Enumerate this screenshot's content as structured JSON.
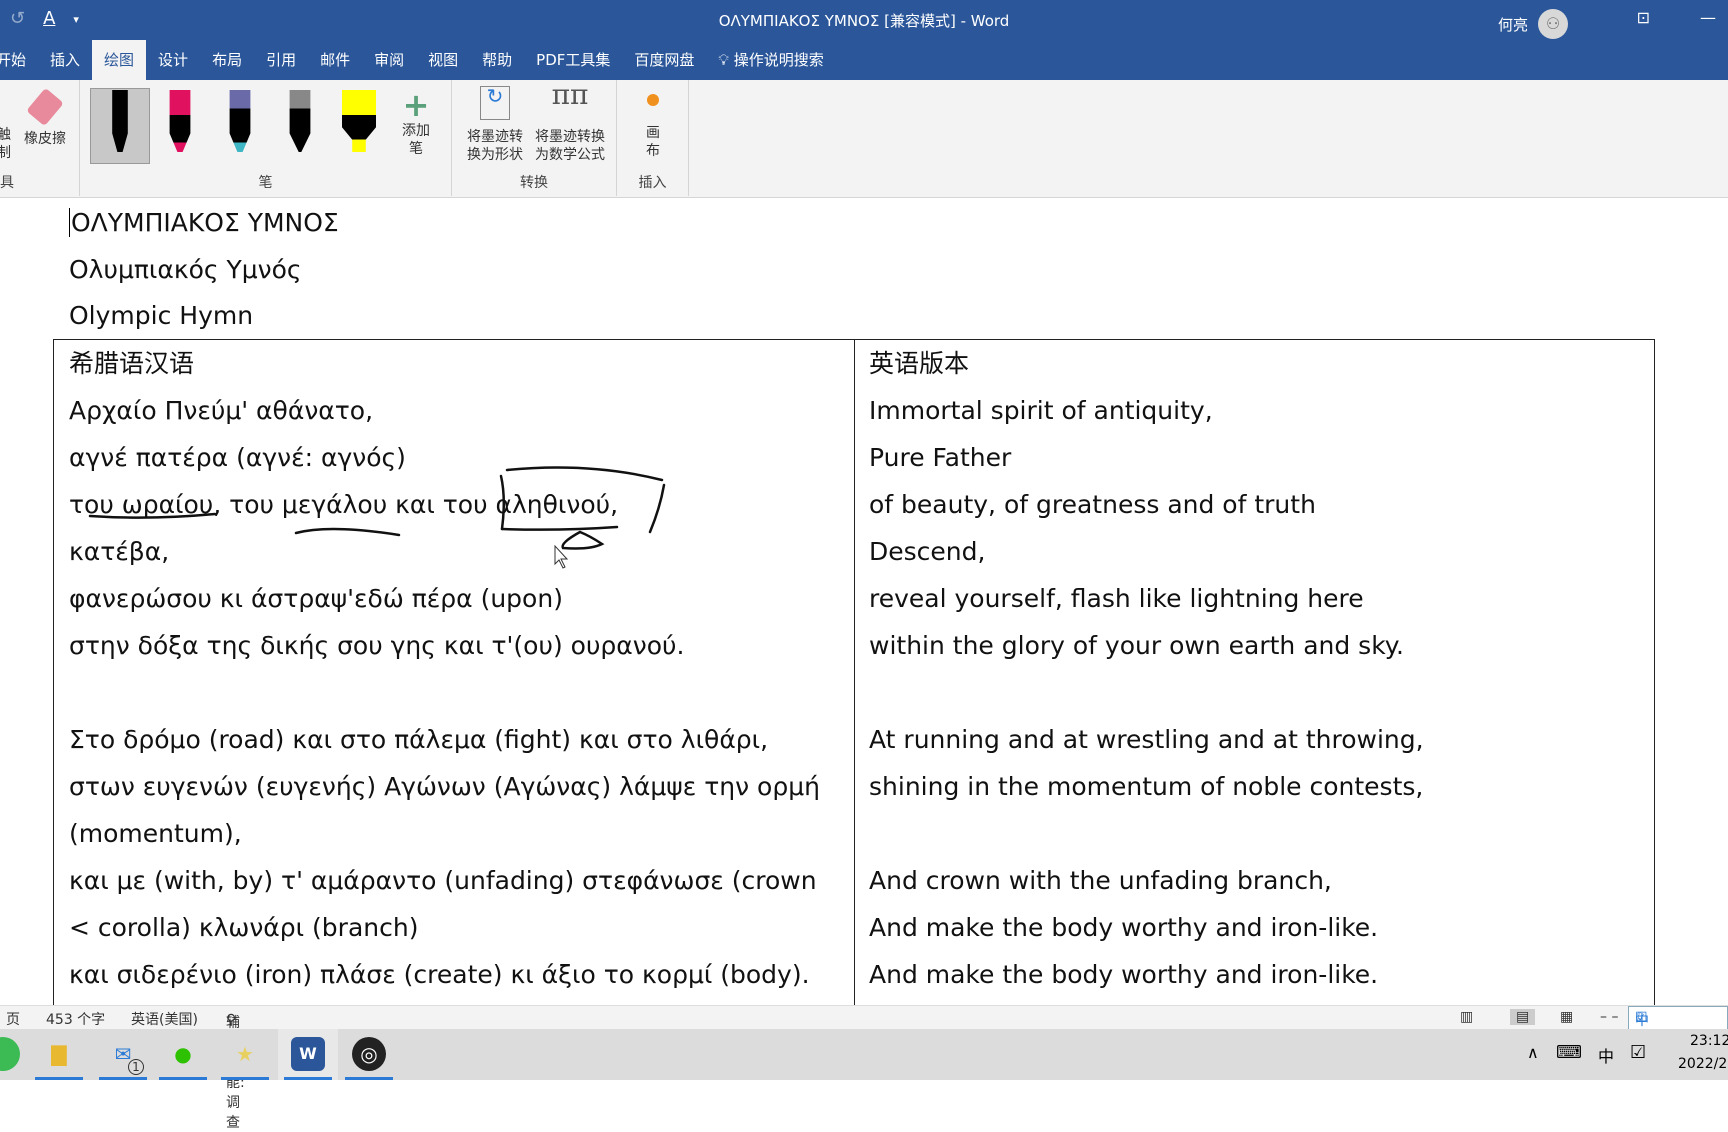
{
  "window": {
    "title": "ΟΛΥΜΠΙΑΚΟΣ ΥΜΝΟΣ [兼容模式]  -  Word",
    "user": "何亮"
  },
  "tabs": [
    "开始",
    "插入",
    "绘图",
    "设计",
    "布局",
    "引用",
    "邮件",
    "审阅",
    "视图",
    "帮助",
    "PDF工具集",
    "百度网盘"
  ],
  "active_tab": "绘图",
  "search_label": "操作说明搜索",
  "ribbon": {
    "tools": {
      "touch_draw": "触\n制",
      "eraser": "橡皮擦",
      "group": "具"
    },
    "pens": {
      "add_pen": "添加\n笔",
      "group": "笔",
      "colors": [
        "#000000",
        "#e0115f",
        "#3fb6c4",
        "#777777",
        "#ffff00"
      ]
    },
    "convert": {
      "to_shape": "将墨迹转\n换为形状",
      "to_math": "将墨迹转换\n为数学公式",
      "group": "转换"
    },
    "insert": {
      "canvas": "画\n布",
      "group": "插入"
    }
  },
  "document": {
    "lines": [
      "ΟΛΥΜΠΙΑΚΟΣ ΥΜΝΟΣ",
      "Ολυμπιακός Υμνός",
      "Olympic Hymn"
    ],
    "table": {
      "headers": [
        "希腊语汉语",
        "英语版本"
      ],
      "left": [
        "Αρχαίο Πνεύμ' αθάνατο,",
        "αγνέ πατέρα (αγνέ: αγνός)",
        "του ωραίου, του μεγάλου και του αληθινού,",
        "κατέβα,",
        "φανερώσου κι άστραψ'εδώ πέρα (upon)",
        "στην δόξα της δικής σου γης και τ'(ου) ουρανού.",
        "",
        "Στο δρόμο (road) και στο πάλεμα (fight) και στο λιθάρι,",
        "στων ευγενών (ευγενής) Αγώνων (Αγώνας) λάμψε την ορμή",
        "(momentum),",
        "και με (with, by) τ' αμάραντο (unfading) στεφάνωσε (crown",
        "< corolla) κλωνάρι (branch)",
        "και σιδερένιο (iron) πλάσε (create) κι άξιο το κορμί (body)."
      ],
      "right": [
        "Immortal spirit of antiquity,",
        "Pure Father",
        "of beauty, of greatness and of truth",
        "Descend,",
        "reveal yourself, flash like lightning here",
        "within the glory of your own earth and sky.",
        "",
        "At running and at wrestling and at throwing,",
        "shining in the momentum of noble contests,",
        "",
        "And crown with the unfading branch,",
        "And make the body worthy and iron-like.",
        "And make the body worthy and iron-like."
      ]
    }
  },
  "status": {
    "page": "页",
    "words": "453 个字",
    "language": "英语(美国)",
    "accessibility": "辅助功能: 调查"
  },
  "ime": {
    "mode": "中"
  },
  "clock": {
    "time": "23:12",
    "date": "2022/2"
  },
  "taskbar": {
    "mail_badge": "1"
  }
}
